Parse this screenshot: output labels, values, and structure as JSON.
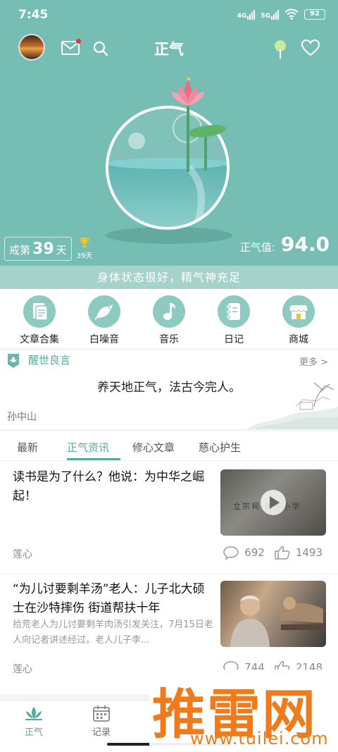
{
  "status_bar": {
    "time": "7:45",
    "network_1": "4G",
    "network_2": "5G",
    "battery": "92"
  },
  "header": {
    "title": "正气"
  },
  "hero": {
    "streak_prefix": "戒第",
    "streak_days": "39",
    "streak_suffix": "天",
    "trophy_days": "39天",
    "score_label": "正气值:",
    "score_value": "94.0",
    "status_message": "身体状态很好，精气神充足"
  },
  "quick_links": [
    {
      "label": "文章合集",
      "icon": "document-icon"
    },
    {
      "label": "白噪音",
      "icon": "bird-icon"
    },
    {
      "label": "音乐",
      "icon": "music-note-icon"
    },
    {
      "label": "日记",
      "icon": "notebook-icon"
    },
    {
      "label": "商城",
      "icon": "shop-icon"
    }
  ],
  "quote": {
    "section_title": "醒世良言",
    "more_label": "更多 >",
    "text": "养天地正气，法古今完人。",
    "author": "孙中山"
  },
  "tabs": [
    {
      "label": "最新"
    },
    {
      "label": "正气资讯",
      "active": true
    },
    {
      "label": "修心文章"
    },
    {
      "label": "慈心护生"
    }
  ],
  "articles": [
    {
      "title": "读书是为了什么？他说：为中华之崛起！",
      "summary": "",
      "author": "莲心",
      "comments": "692",
      "likes": "1493",
      "thumb_text": "立宗祠 牧羊小学"
    },
    {
      "title": "“为儿讨要剩羊汤”老人：儿子北大硕士在沙特摔伤 街道帮扶十年",
      "summary": "拾荒老人为儿讨要剩羊肉汤引发关注，7月15日老人向记者讲述经过。老人儿子李...",
      "author": "莲心",
      "comments": "744",
      "likes": "2148"
    }
  ],
  "bottom_nav": [
    {
      "label": "正气",
      "active": true
    },
    {
      "label": "记录"
    }
  ],
  "watermark": {
    "text": "推雷网",
    "url": "www.tuilei.com"
  },
  "colors": {
    "primary": "#76bdb3",
    "accent": "#55a99d",
    "strip": "#a5d3ca",
    "watermark": "#f07b1d"
  }
}
